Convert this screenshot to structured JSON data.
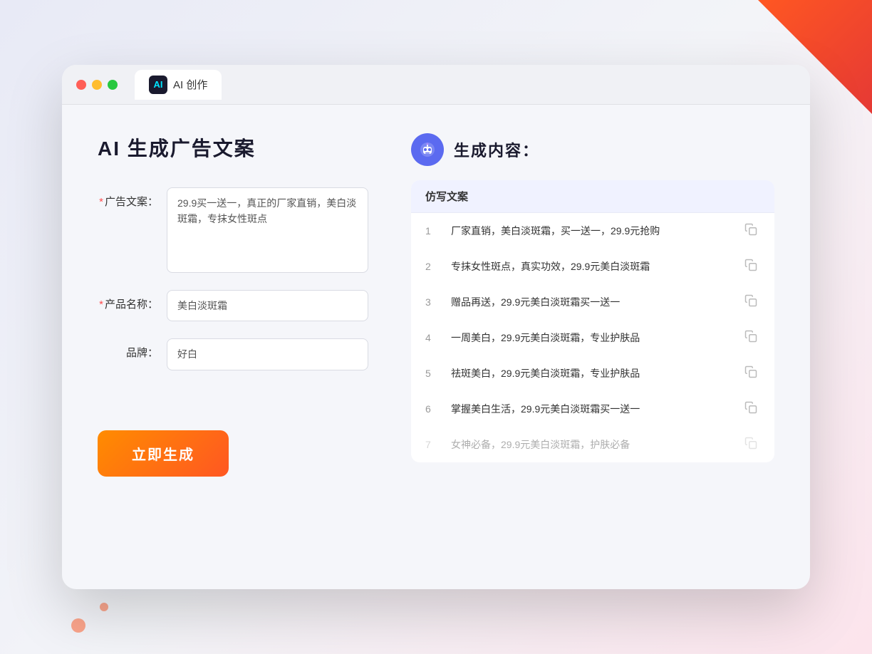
{
  "window": {
    "tab_icon": "AI",
    "tab_label": "AI 创作"
  },
  "left_panel": {
    "page_title": "AI 生成广告文案",
    "form": {
      "ad_copy_label": "广告文案：",
      "ad_copy_required": "*",
      "ad_copy_value": "29.9买一送一，真正的厂家直销，美白淡斑霜，专抹女性斑点",
      "product_label": "产品名称：",
      "product_required": "*",
      "product_value": "美白淡斑霜",
      "brand_label": "品牌：",
      "brand_value": "好白"
    },
    "generate_button": "立即生成"
  },
  "right_panel": {
    "title": "生成内容：",
    "column_header": "仿写文案",
    "results": [
      {
        "num": 1,
        "text": "厂家直销，美白淡斑霜，买一送一，29.9元抢购",
        "dimmed": false
      },
      {
        "num": 2,
        "text": "专抹女性斑点，真实功效，29.9元美白淡斑霜",
        "dimmed": false
      },
      {
        "num": 3,
        "text": "赠品再送，29.9元美白淡斑霜买一送一",
        "dimmed": false
      },
      {
        "num": 4,
        "text": "一周美白，29.9元美白淡斑霜，专业护肤品",
        "dimmed": false
      },
      {
        "num": 5,
        "text": "祛斑美白，29.9元美白淡斑霜，专业护肤品",
        "dimmed": false
      },
      {
        "num": 6,
        "text": "掌握美白生活，29.9元美白淡斑霜买一送一",
        "dimmed": false
      },
      {
        "num": 7,
        "text": "女神必备，29.9元美白淡斑霜，护肤必备",
        "dimmed": true
      }
    ]
  },
  "colors": {
    "accent": "#ff5722",
    "brand": "#5b6af0"
  }
}
